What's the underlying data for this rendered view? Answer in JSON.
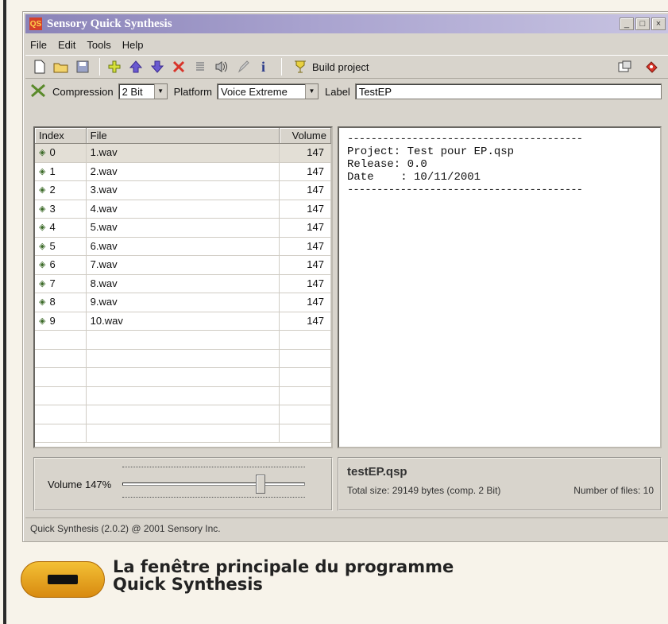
{
  "window": {
    "title": "Sensory Quick Synthesis",
    "icon_glyph": "QS"
  },
  "window_buttons": {
    "minimize": "_",
    "maximize": "□",
    "close": "×"
  },
  "menu": [
    "File",
    "Edit",
    "Tools",
    "Help"
  ],
  "toolbar": {
    "icons": [
      "new-file-icon",
      "open-folder-icon",
      "save-icon",
      "add-icon",
      "move-up-icon",
      "move-down-icon",
      "delete-icon",
      "list-icon",
      "speaker-icon",
      "edit-icon",
      "info-icon"
    ],
    "build_label": "Build project",
    "right_icons": [
      "properties-icon",
      "exit-icon"
    ]
  },
  "options": {
    "compression_label": "Compression",
    "compression_value": "2 Bit",
    "platform_label": "Platform",
    "platform_value": "Voice Extreme",
    "label_label": "Label",
    "label_value": "TestEP"
  },
  "table": {
    "headers": [
      "Index",
      "File",
      "Volume"
    ],
    "rows": [
      {
        "index": "0",
        "file": "1.wav",
        "volume": "147"
      },
      {
        "index": "1",
        "file": "2.wav",
        "volume": "147"
      },
      {
        "index": "2",
        "file": "3.wav",
        "volume": "147"
      },
      {
        "index": "3",
        "file": "4.wav",
        "volume": "147"
      },
      {
        "index": "4",
        "file": "5.wav",
        "volume": "147"
      },
      {
        "index": "5",
        "file": "6.wav",
        "volume": "147"
      },
      {
        "index": "6",
        "file": "7.wav",
        "volume": "147"
      },
      {
        "index": "7",
        "file": "8.wav",
        "volume": "147"
      },
      {
        "index": "8",
        "file": "9.wav",
        "volume": "147"
      },
      {
        "index": "9",
        "file": "10.wav",
        "volume": "147"
      }
    ],
    "selected_row": 0,
    "empty_rows": 6
  },
  "info": {
    "separator": "----------------------------------------",
    "project_label": "Project:",
    "project_value": "Test pour EP.qsp",
    "release_label": "Release:",
    "release_value": "0.0",
    "date_label": "Date    :",
    "date_value": "10/11/2001"
  },
  "volume": {
    "label": "Volume 147%",
    "level": 0.77
  },
  "project": {
    "filename": "testEP.qsp",
    "total_size": "Total size: 29149 bytes (comp. 2 Bit)",
    "num_files": "Number of files: 10"
  },
  "status": "Quick Synthesis (2.0.2) @ 2001 Sensory Inc.",
  "caption": {
    "line1": "La fenêtre principale du programme",
    "line2": "Quick Synthesis"
  },
  "colors": {
    "titlebar": "#8a83b8",
    "caption_pill": "#e0a020",
    "window_bg": "#d8d4cc"
  }
}
